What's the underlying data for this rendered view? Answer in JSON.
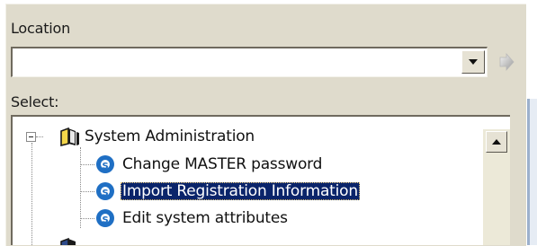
{
  "location": {
    "label": "Location",
    "value": "",
    "go_icon": "go-arrow-icon"
  },
  "select": {
    "label": "Select:"
  },
  "tree": {
    "root": {
      "label": "System Administration",
      "icon": "book-icon",
      "expanded": true
    },
    "children": [
      {
        "label": "Change MASTER password",
        "icon": "cs-app-icon",
        "selected": false
      },
      {
        "label": "Import Registration Information",
        "icon": "cs-app-icon",
        "selected": true
      },
      {
        "label": "Edit system attributes",
        "icon": "cs-app-icon",
        "selected": false
      }
    ]
  },
  "colors": {
    "panel_bg": "#dfdbcc",
    "selection_bg": "#0a246a",
    "icon_blue": "#1f6fc4"
  }
}
